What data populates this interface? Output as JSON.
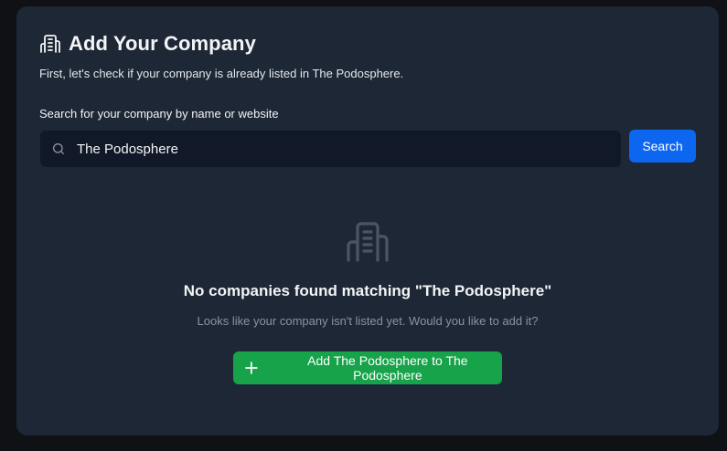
{
  "header": {
    "title": "Add Your Company",
    "icon": "building-icon"
  },
  "subtitle": "First, let's check if your company is already listed in The Podosphere.",
  "search": {
    "label": "Search for your company by name or website",
    "value": "The Podosphere",
    "button_label": "Search",
    "icon": "search-icon"
  },
  "empty_state": {
    "icon": "building-icon",
    "title": "No companies found matching \"The Podosphere\"",
    "message": "Looks like your company isn't listed yet. Would you like to add it?",
    "add_button_label": "Add The Podosphere to The Podosphere",
    "add_button_icon": "plus-icon"
  },
  "colors": {
    "background": "#0f1115",
    "card": "#1e2736",
    "input_bg": "#111827",
    "primary": "#0d66f0",
    "success": "#16a34a",
    "muted_text": "#8b93a1",
    "icon_muted": "#4b5565"
  }
}
